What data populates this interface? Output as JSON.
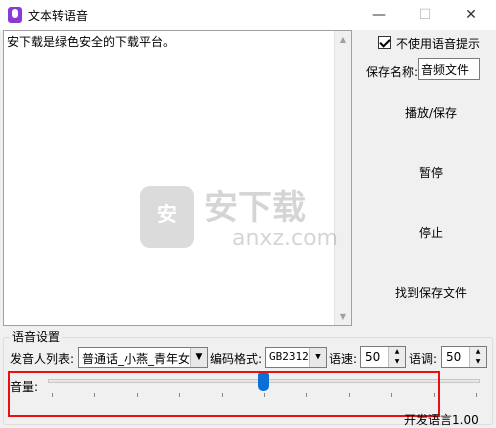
{
  "window": {
    "title": "文本转语音",
    "minimize": "—",
    "maximize": "☐",
    "close": "✕"
  },
  "editor": {
    "text": "安下载是绿色安全的下载平台。"
  },
  "watermark": {
    "bag_char": "安",
    "cn": "安下载",
    "en": "anxz.com"
  },
  "options": {
    "no_prompt_label": "不使用语音提示",
    "no_prompt_checked": true
  },
  "save": {
    "label": "保存名称:",
    "value": "音频文件"
  },
  "buttons": {
    "play_save": "播放/保存",
    "pause": "暂停",
    "stop": "停止",
    "find": "找到保存文件"
  },
  "voice_settings": {
    "group_title": "语音设置",
    "speaker_label": "发音人列表:",
    "speaker_value": "普通话_小燕_青年女",
    "encoding_label": "编码格式:",
    "encoding_value": "GB2312",
    "speed_label": "语速:",
    "speed_value": "50",
    "pitch_label": "语调:",
    "pitch_value": "50",
    "volume_label": "音量:",
    "volume_level": 0.5
  },
  "footer": {
    "text": "开发语言1.00"
  },
  "colors": {
    "accent": "#0a6fd6",
    "highlight": "#e81010"
  }
}
